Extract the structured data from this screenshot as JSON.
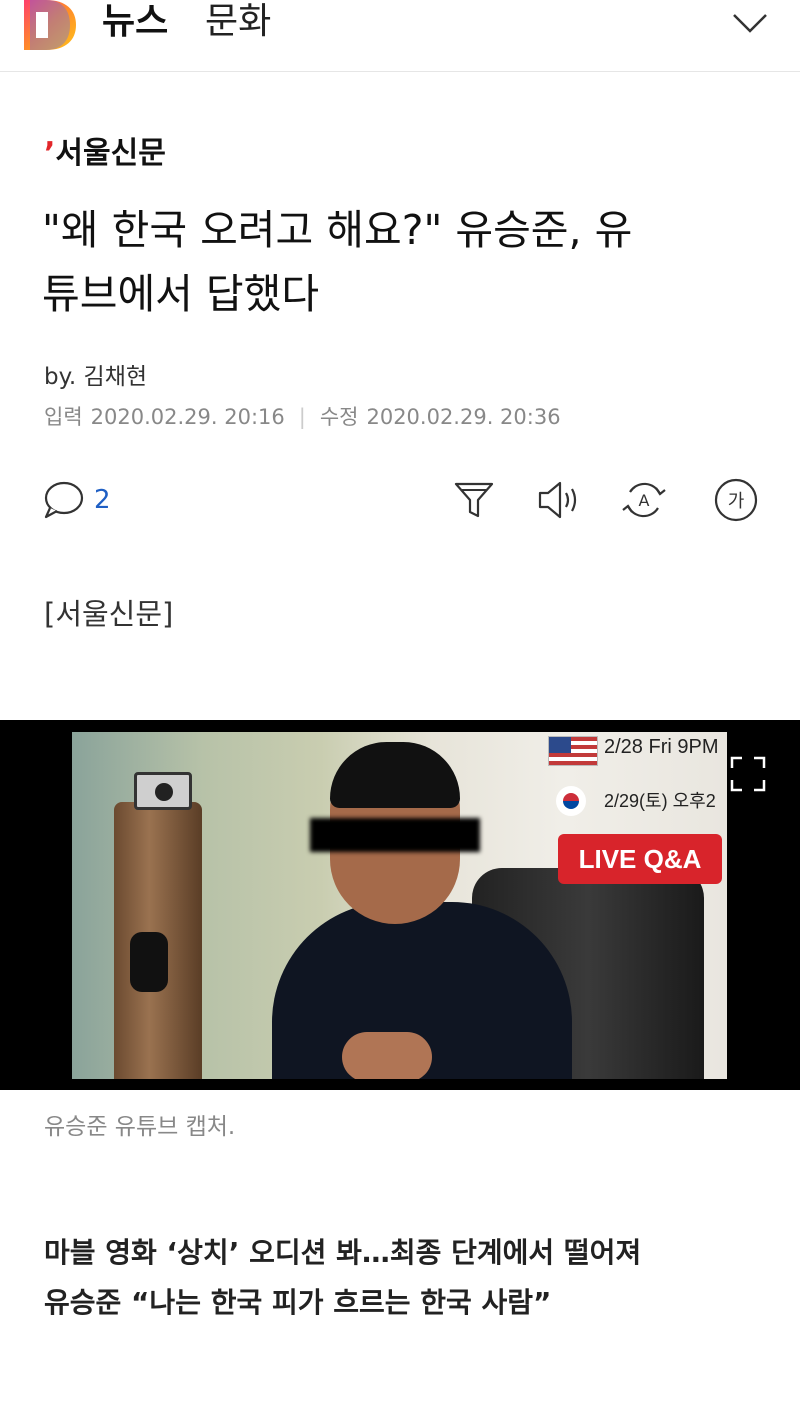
{
  "header": {
    "logo_letter": "D",
    "section": "뉴스",
    "subsection": "문화",
    "menu_icon": "chevron-down-icon"
  },
  "article": {
    "press_name": "서울신문",
    "headline_line1": "\"왜 한국 오려고 해요?\" 유승준, 유",
    "headline_line2": "튜브에서 답했다",
    "byline": "by. 김채현",
    "input_label": "입력",
    "input_date": "2020.02.29. 20:16",
    "modified_label": "수정",
    "modified_date": "2020.02.29. 20:36",
    "source_tag": "[서울신문]",
    "photo_caption": "유승준 유튜브 캡처.",
    "subhead_line1": "마블 영화 ‘상치’ 오디션 봐…최종 단계에서 떨어져",
    "subhead_line2": "유승준 “나는 한국 피가 흐르는 한국 사람”"
  },
  "toolbar": {
    "comment_count": "2",
    "icons": [
      "comment-icon",
      "filter-icon",
      "audio-icon",
      "translate-icon",
      "font-size-icon"
    ],
    "font_label": "가",
    "translate_label": "A"
  },
  "video_overlay": {
    "date_us": "2/28 Fri 9PM",
    "date_kr": "2/29(토) 오후2",
    "live_label": "LIVE Q&A"
  },
  "colors": {
    "accent_blue": "#1f5fc4",
    "press_red": "#e2262a",
    "live_red": "#d8242b"
  }
}
